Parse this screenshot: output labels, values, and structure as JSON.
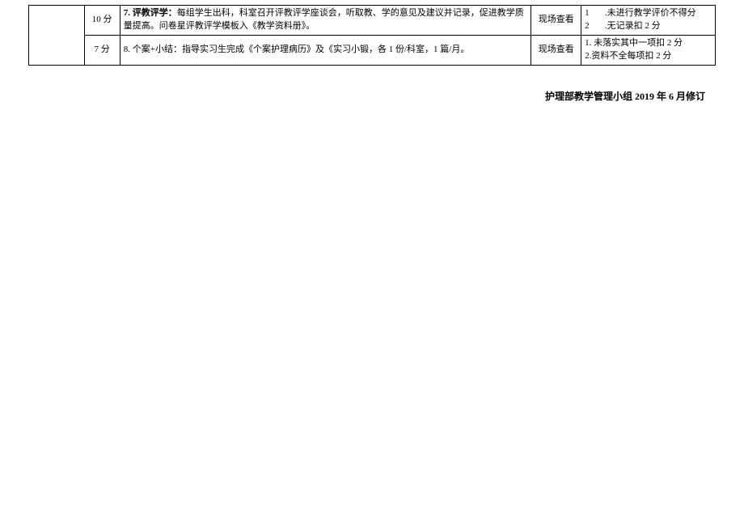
{
  "table": {
    "rows": [
      {
        "score": "10 分",
        "desc_label": "7. 评教评学：",
        "desc_body": "每组学生出科，科室召开评教评学座谈会，听取教、学的意见及建议并记录，促进教学质量提高。问卷星评教评学模板入《教学资料册》。",
        "method": "现场查看",
        "criteria_line1_num": "1",
        "criteria_line1_text": ".未进行教学评价不得分",
        "criteria_line2_num": "2",
        "criteria_line2_text": ".无记录扣 2 分"
      },
      {
        "score": "7 分",
        "desc_full": "8. 个案+小结：指导实习生完成《个案护理病历》及《实习小锻，各 1 份/科室，1 篇/月。",
        "method": "现场查看",
        "criteria_line1_full": "1. 未落实其中一项扣 2 分",
        "criteria_line2_full": "2.资料不全每项扣 2 分"
      }
    ]
  },
  "footer": "护理部教学管理小组 2019 年 6 月修订"
}
